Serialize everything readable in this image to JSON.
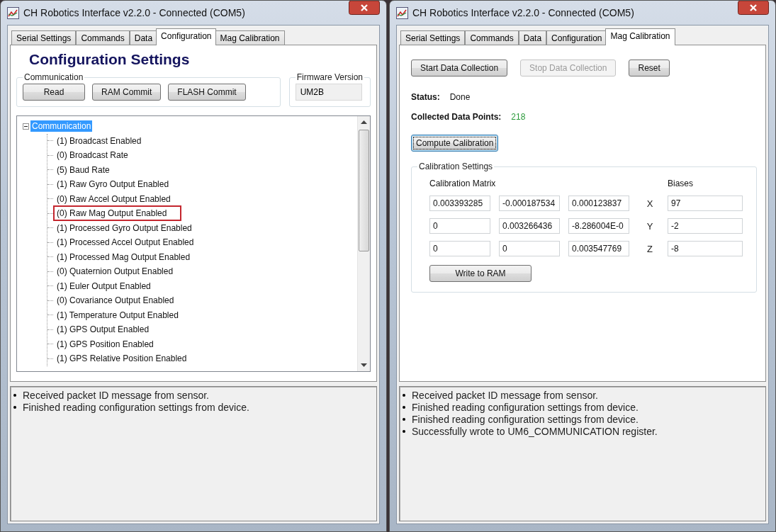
{
  "windows": [
    {
      "title": "CH Robotics Interface v2.2.0 - Connected (COM5)",
      "tabs": [
        {
          "label": "Serial Settings",
          "selected": false
        },
        {
          "label": "Commands",
          "selected": false
        },
        {
          "label": "Data",
          "selected": false
        },
        {
          "label": "Configuration",
          "selected": true
        },
        {
          "label": "Mag Calibration",
          "selected": false
        }
      ],
      "content": {
        "kind": "configuration",
        "heading": "Configuration Settings",
        "communication": {
          "label": "Communication",
          "buttons": [
            "Read",
            "RAM Commit",
            "FLASH Commit"
          ]
        },
        "firmware": {
          "label": "Firmware Version",
          "value": "UM2B"
        },
        "tree": [
          {
            "label": "Communication",
            "selected": true,
            "expanded": true,
            "outlined": false,
            "children": [
              {
                "label": "(1) Broadcast Enabled",
                "selected": false,
                "outlined": false
              },
              {
                "label": "(0) Broadcast Rate",
                "selected": false,
                "outlined": false
              },
              {
                "label": "(5) Baud Rate",
                "selected": false,
                "outlined": false
              },
              {
                "label": "(1) Raw Gyro Output Enabled",
                "selected": false,
                "outlined": false
              },
              {
                "label": "(0) Raw Accel Output Enabled",
                "selected": false,
                "outlined": false
              },
              {
                "label": "(0) Raw Mag Output Enabled",
                "selected": false,
                "outlined": true
              },
              {
                "label": "(1) Processed Gyro Output Enabled",
                "selected": false,
                "outlined": false
              },
              {
                "label": "(1) Processed Accel Output Enabled",
                "selected": false,
                "outlined": false
              },
              {
                "label": "(1) Processed Mag Output Enabled",
                "selected": false,
                "outlined": false
              },
              {
                "label": "(0) Quaternion Output Enabled",
                "selected": false,
                "outlined": false
              },
              {
                "label": "(1) Euler Output Enabled",
                "selected": false,
                "outlined": false
              },
              {
                "label": "(0) Covariance Output Enabled",
                "selected": false,
                "outlined": false
              },
              {
                "label": "(1) Temperature Output Enabled",
                "selected": false,
                "outlined": false
              },
              {
                "label": "(1) GPS Output Enabled",
                "selected": false,
                "outlined": false
              },
              {
                "label": "(1) GPS Position Enabled",
                "selected": false,
                "outlined": false
              },
              {
                "label": "(1) GPS Relative Position Enabled",
                "selected": false,
                "outlined": false
              }
            ]
          }
        ]
      },
      "log": [
        "Received packet ID message from sensor.",
        "Finished reading configuration settings from device."
      ]
    },
    {
      "title": "CH Robotics Interface v2.2.0 - Connected (COM5)",
      "tabs": [
        {
          "label": "Serial Settings",
          "selected": false
        },
        {
          "label": "Commands",
          "selected": false
        },
        {
          "label": "Data",
          "selected": false
        },
        {
          "label": "Configuration",
          "selected": false
        },
        {
          "label": "Mag Calibration",
          "selected": true
        }
      ],
      "content": {
        "kind": "mag_calibration",
        "buttons": [
          {
            "label": "Start Data Collection",
            "disabled": false
          },
          {
            "label": "Stop Data Collection",
            "disabled": true
          },
          {
            "label": "Reset",
            "disabled": false
          }
        ],
        "status": {
          "label": "Status:",
          "value": "Done"
        },
        "collected": {
          "label": "Collected Data Points:",
          "value": "218"
        },
        "compute": {
          "label": "Compute Calibration",
          "focused": true
        },
        "group": {
          "label": "Calibration Settings",
          "matrix_label": "Calibration Matrix",
          "biases_label": "Biases",
          "rows": [
            {
              "matrix": [
                "0.003393285",
                "-0.000187534",
                "0.000123837"
              ],
              "axis": "X",
              "bias": "97"
            },
            {
              "matrix": [
                "0",
                "0.003266436",
                "-8.286004E-0"
              ],
              "axis": "Y",
              "bias": "-2"
            },
            {
              "matrix": [
                "0",
                "0",
                "0.003547769"
              ],
              "axis": "Z",
              "bias": "-8"
            }
          ],
          "write": "Write to RAM"
        }
      },
      "log": [
        "Received packet ID message from sensor.",
        "Finished reading configuration settings from device.",
        "Finished reading configuration settings from device.",
        "Successfully wrote to UM6_COMMUNICATION register."
      ]
    }
  ]
}
